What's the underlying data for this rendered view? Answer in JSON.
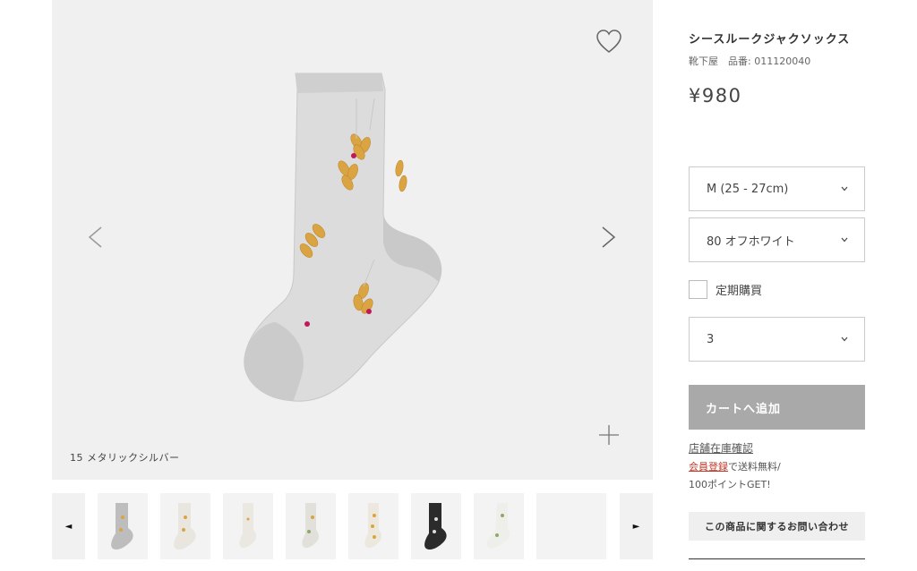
{
  "product": {
    "name": "シースルークジャクソックス",
    "brand_line": "靴下屋　品番: 011120040",
    "price": "¥980",
    "image_caption": "15 メタリックシルバー"
  },
  "options": {
    "size": "M (25 - 27cm)",
    "color": "80 オフホワイト",
    "quantity": "3",
    "subscribe_label": "定期購買"
  },
  "actions": {
    "add_to_cart": "カートへ追加",
    "store_stock": "店舗在庫確認",
    "member_register": "会員登録",
    "promo_text": "で送料無料/",
    "promo_points": "100ポイントGET!",
    "inquiry": "この商品に関するお問い合わせ"
  },
  "thumbnails": {
    "prev_arrow": "◄",
    "next_arrow": "►"
  },
  "colors": {
    "image_bg": "#f0f0f0",
    "cart_button": "#a9a9a9",
    "link_red": "#c0392b"
  }
}
